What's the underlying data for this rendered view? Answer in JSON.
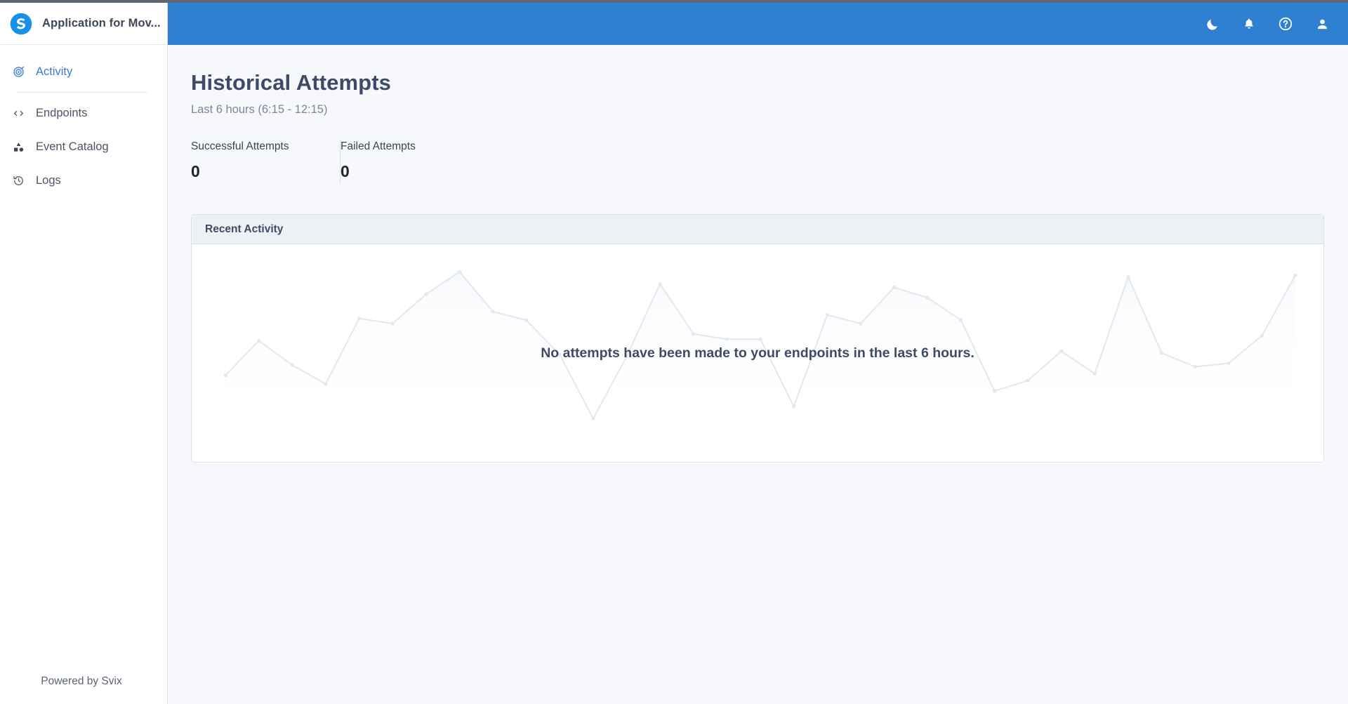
{
  "theme": {
    "header_blue": "#2F80D0",
    "accent_blue": "#3A7BD5",
    "text_dark": "#3D4B66",
    "muted": "#7A8699",
    "card_header_bg": "#EDF0F4",
    "border": "#DDE2EA",
    "placeholder_line": "#E3E8F0"
  },
  "sidebar": {
    "brand_title": "Application for Mov...",
    "logo_icon": "svix-logo-icon",
    "items": [
      {
        "label": "Activity",
        "icon": "activity-icon",
        "active": true
      },
      {
        "label": "Endpoints",
        "icon": "code-brackets-icon",
        "active": false
      },
      {
        "label": "Event Catalog",
        "icon": "shapes-icon",
        "active": false
      },
      {
        "label": "Logs",
        "icon": "history-clock-icon",
        "active": false
      }
    ],
    "footer": "Powered by Svix"
  },
  "topbar": {
    "icons": [
      {
        "name": "dark-mode-icon",
        "glyph": "moon"
      },
      {
        "name": "notifications-icon",
        "glyph": "bell"
      },
      {
        "name": "help-icon",
        "glyph": "question-circle"
      },
      {
        "name": "profile-icon",
        "glyph": "person"
      }
    ]
  },
  "main": {
    "title": "Historical Attempts",
    "subtitle": "Last 6 hours (6:15 - 12:15)",
    "stats": [
      {
        "label": "Successful Attempts",
        "value": "0"
      },
      {
        "label": "Failed Attempts",
        "value": "0"
      }
    ],
    "card": {
      "header": "Recent Activity",
      "empty_message": "No attempts have been made to your endpoints in the last 6 hours."
    }
  },
  "chart_data": {
    "type": "line",
    "title": "Recent Activity",
    "subtitle": "Last 6 hours (6:15 - 12:15)",
    "xlabel": "",
    "ylabel": "",
    "grid": false,
    "legend": false,
    "note": "Decorative faded placeholder line (no real data); values are relative 0-100 heights read off the rendered polyline.",
    "x": [
      0,
      1,
      2,
      3,
      4,
      5,
      6,
      7,
      8,
      9,
      10,
      11,
      12,
      13,
      14,
      15,
      16,
      17,
      18,
      19,
      20,
      21,
      22,
      23,
      24,
      25,
      26,
      27,
      28,
      29,
      30,
      31
    ],
    "series": [
      {
        "name": "placeholder",
        "color": "#E3E8F0",
        "values": [
          33,
          53,
          39,
          28,
          66,
          63,
          80,
          93,
          70,
          65,
          45,
          8,
          44,
          86,
          57,
          54,
          54,
          15,
          68,
          63,
          84,
          78,
          65,
          24,
          30,
          47,
          34,
          90,
          46,
          38,
          40,
          56,
          91
        ]
      }
    ],
    "ylim": [
      0,
      100
    ],
    "xlim": [
      0,
      32
    ]
  }
}
